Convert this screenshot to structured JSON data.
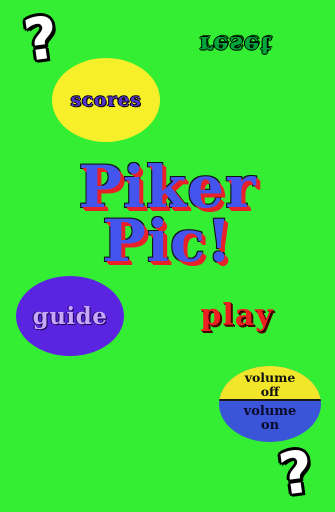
{
  "help_top": {
    "text": "?"
  },
  "help_bottom": {
    "text": "?"
  },
  "reset": {
    "label": "reset"
  },
  "scores": {
    "label": "scores"
  },
  "title": {
    "line1": "Piker",
    "line2": "Pic!"
  },
  "guide": {
    "label": "guide"
  },
  "play": {
    "label": "play"
  },
  "volume": {
    "off_line1": "volume",
    "off_line2": "off",
    "on_line1": "volume",
    "on_line2": "on"
  },
  "colors": {
    "background": "#33ee33",
    "scores_circle": "#f6ef2a",
    "guide_circle": "#5a24e0",
    "title_fill": "#4455ee",
    "title_shadow": "#e8202a",
    "play_text": "#ee2020",
    "volume_off_fill": "#f2e62a",
    "volume_on_fill": "#3a55d8"
  },
  "icons": {
    "help": "question-mark-icon"
  }
}
